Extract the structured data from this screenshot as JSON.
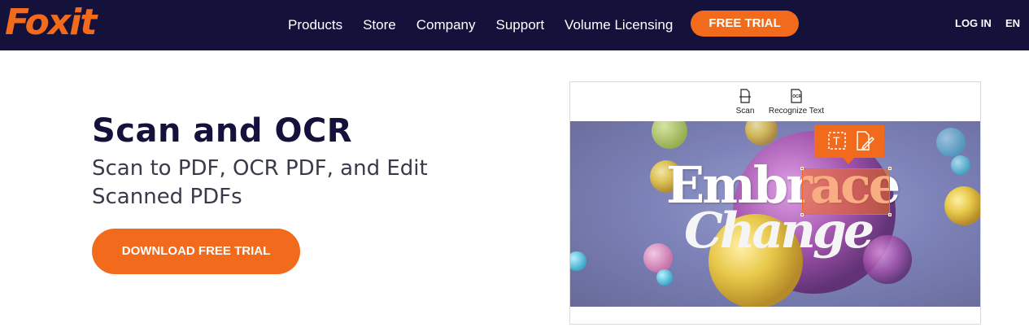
{
  "header": {
    "logo_text": "Foxit",
    "nav": [
      "Products",
      "Store",
      "Company",
      "Support",
      "Volume Licensing"
    ],
    "trial_button": "FREE TRIAL",
    "login": "LOG IN",
    "language": "EN"
  },
  "hero": {
    "title": "Scan and OCR",
    "subtitle": "Scan to PDF, OCR PDF, and Edit Scanned PDFs",
    "download_button": "DOWNLOAD FREE TRIAL"
  },
  "preview": {
    "toolbar": {
      "scan_label": "Scan",
      "ocr_icon_text": "OCR",
      "ocr_label": "Recognize Text"
    },
    "image_text": {
      "line1": "Embrace",
      "line2": "Change"
    },
    "popup_icons": [
      "text-box-icon",
      "edit-document-icon"
    ]
  },
  "colors": {
    "accent": "#f26a1b",
    "nav_bg": "#14113a",
    "title": "#14113a"
  }
}
